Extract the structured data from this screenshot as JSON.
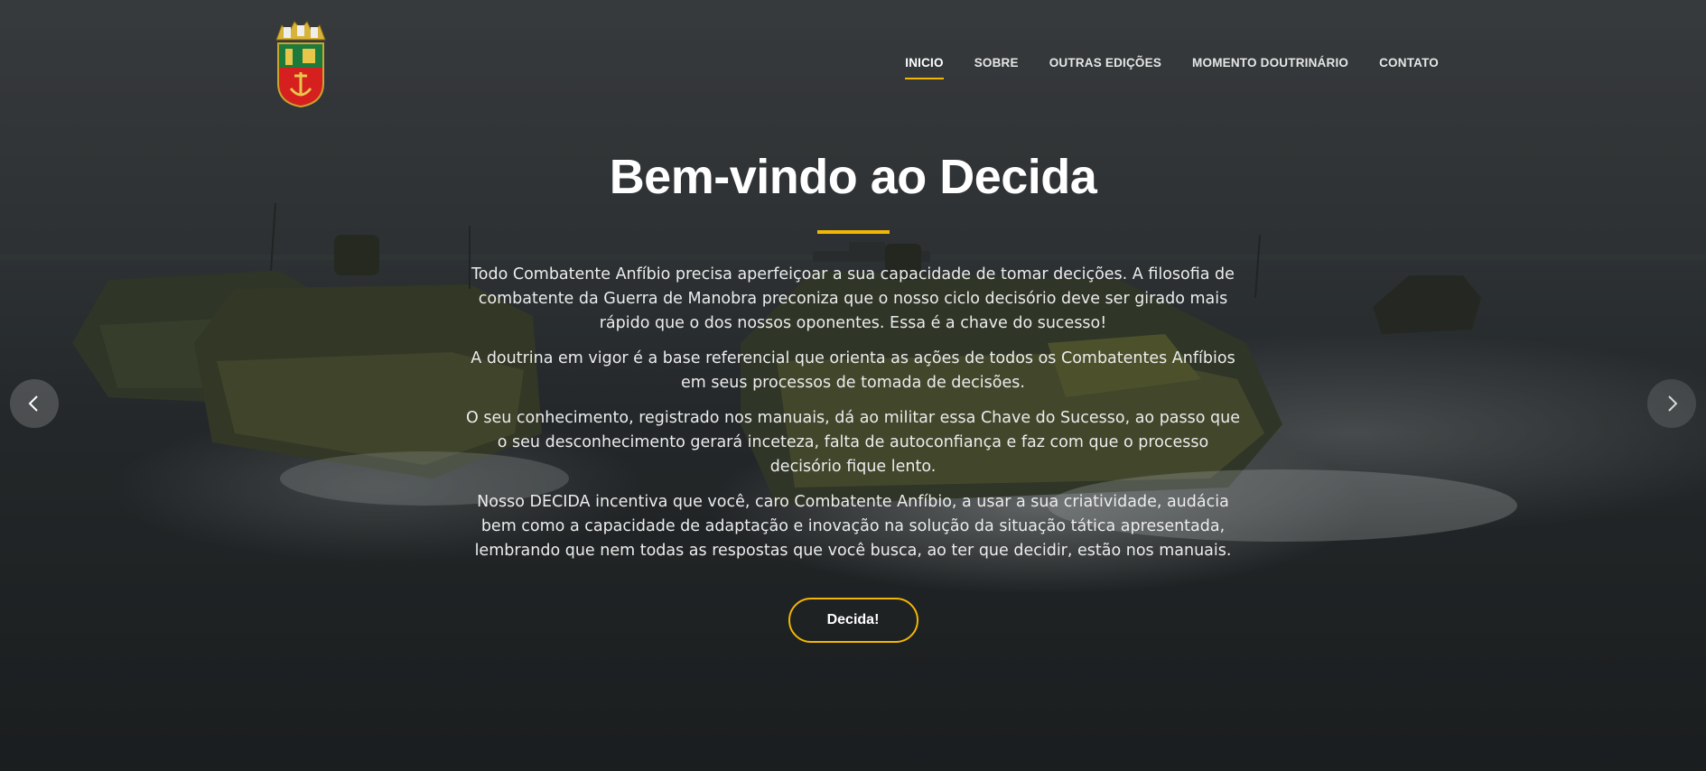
{
  "header": {
    "logo_icon": "naval-coat-of-arms-icon",
    "nav": [
      {
        "label": "INICIO",
        "active": true
      },
      {
        "label": "SOBRE",
        "active": false
      },
      {
        "label": "OUTRAS EDIÇÕES",
        "active": false
      },
      {
        "label": "MOMENTO DOUTRINÁRIO",
        "active": false
      },
      {
        "label": "CONTATO",
        "active": false
      }
    ]
  },
  "hero": {
    "title": "Bem-vindo ao Decida",
    "paragraphs": [
      "Todo Combatente Anfíbio precisa aperfeiçoar a sua capacidade de tomar decições. A filosofia de combatente da Guerra de Manobra preconiza que o nosso ciclo decisório deve ser girado mais rápido que o dos nossos oponentes. Essa é a chave do sucesso!",
      "A doutrina em vigor é a base referencial que orienta as ações de todos os Combatentes Anfíbios em seus processos de tomada de decisões.",
      "O seu conhecimento, registrado nos manuais, dá ao militar essa Chave do Sucesso, ao passo que o seu desconhecimento gerará inceteza, falta de autoconfiança e faz com que o processo decisório fique lento.",
      "Nosso DECIDA incentiva que você, caro Combatente Anfíbio, a usar a sua criatividade, audácia bem como a capacidade de adaptação e inovação na solução da situação tática apresentada, lembrando que nem todas as respostas que você busca, ao ter que decidir, estão nos manuais."
    ],
    "cta_label": "Decida!",
    "prev_icon": "chevron-left-icon",
    "next_icon": "chevron-right-icon"
  },
  "colors": {
    "accent": "#f2b705",
    "text": "#ffffff"
  }
}
